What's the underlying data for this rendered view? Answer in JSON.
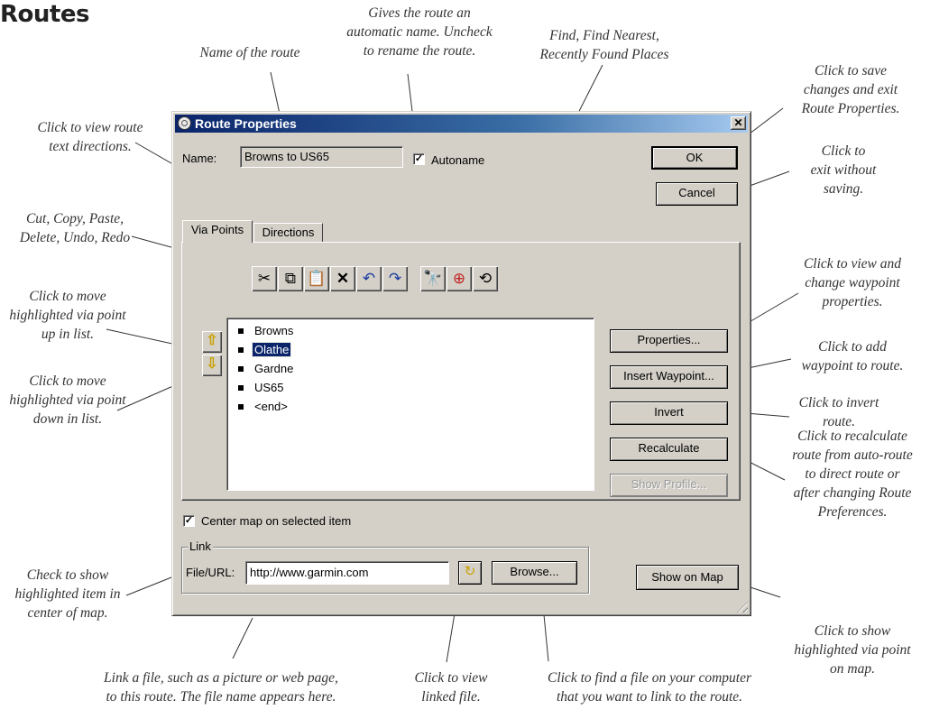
{
  "page": {
    "title": "Routes"
  },
  "callouts": {
    "autoname": "Gives the route an\nautomatic name. Uncheck\nto rename the route.",
    "find": "Find, Find Nearest,\nRecently Found Places",
    "name": "Name of the route",
    "ok": "Click to save\nchanges and exit\nRoute Properties.",
    "cancel": "Click to\nexit without\nsaving.",
    "directions": "Click to view route\ntext directions.",
    "edit": "Cut, Copy, Paste,\nDelete, Undo, Redo",
    "move_up": "Click to move\nhighlighted via point\nup in list.",
    "move_down": "Click to move\nhighlighted via point\ndown in list.",
    "properties": "Click to view and\nchange waypoint\nproperties.",
    "insert": "Click to add\nwaypoint to route.",
    "invert": "Click to invert\nroute.",
    "recalculate": "Click to recalculate\nroute from auto-route\nto direct route or\nafter changing Route\nPreferences.",
    "center": "Check to show\nhighlighted item in\ncenter of map.",
    "show_map": "Click to show\nhighlighted via point\non map.",
    "link_file": "Link a file, such as a picture or web page,\nto this route. The file name appears here.",
    "view_linked": "Click to view\nlinked file.",
    "browse": "Click to find a file on your computer\nthat you want to link to the route."
  },
  "dialog": {
    "title": "Route Properties",
    "close_label": "✕",
    "name_label": "Name:",
    "name_value": "Browns to US65",
    "autoname_label": "Autoname",
    "autoname_checked": true,
    "ok_label": "OK",
    "cancel_label": "Cancel",
    "tabs": [
      {
        "label": "Via Points",
        "active": true
      },
      {
        "label": "Directions",
        "active": false
      }
    ],
    "toolbar": {
      "edit_icons": [
        "scissors-icon",
        "copy-icon",
        "paste-icon",
        "delete-icon",
        "undo-icon",
        "redo-icon"
      ],
      "find_icons": [
        "binoculars-icon",
        "find-nearest-icon",
        "recently-found-icon"
      ]
    },
    "via_points": [
      "Browns",
      "Olathe",
      "Gardne",
      "US65",
      "<end>"
    ],
    "selected_via_point": "Olathe",
    "side_buttons": {
      "properties": "Properties...",
      "insert_waypoint": "Insert Waypoint...",
      "invert": "Invert",
      "recalculate": "Recalculate",
      "show_profile": "Show Profile..."
    },
    "center_map_label": "Center map on selected item",
    "center_map_checked": true,
    "link": {
      "group_label": "Link",
      "file_label": "File/URL:",
      "file_value": "http://www.garmin.com",
      "browse_label": "Browse..."
    },
    "show_on_map_label": "Show on Map"
  },
  "colors": {
    "face": "#d4d0c8",
    "titlebar": "#0a246a",
    "selection": "#0a246a",
    "arrow": "#e6c000"
  }
}
